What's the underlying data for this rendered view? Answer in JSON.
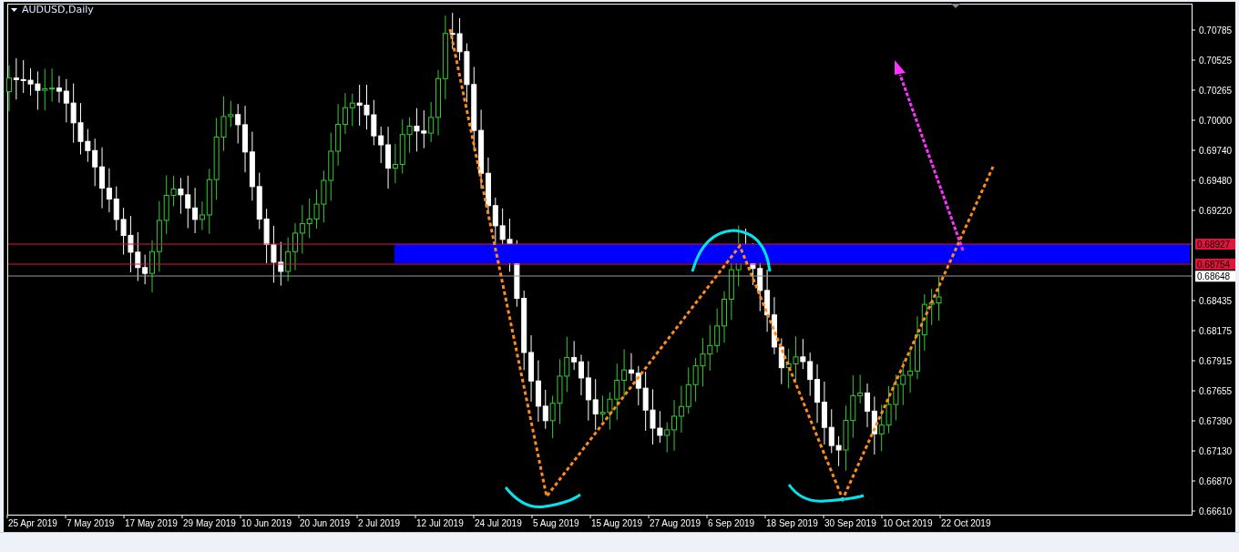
{
  "chart": {
    "title": "AUDUSD,Daily",
    "price_axis": [
      "0.70785",
      "0.70525",
      "0.70265",
      "0.70000",
      "0.69740",
      "0.69480",
      "0.69220",
      "0.68435",
      "0.68175",
      "0.67915",
      "0.67655",
      "0.67390",
      "0.67130",
      "0.66870",
      "0.66610"
    ],
    "price_tags": [
      {
        "label": "0.68927",
        "color": "#e0143c"
      },
      {
        "label": "0.68754",
        "color": "#e0143c"
      },
      {
        "label": "0.68648",
        "color": "#ffffff"
      }
    ],
    "date_axis": [
      "25 Apr 2019",
      "7 May 2019",
      "17 May 2019",
      "29 May 2019",
      "10 Jun 2019",
      "20 Jun 2019",
      "2 Jul 2019",
      "12 Jul 2019",
      "24 Jul 2019",
      "5 Aug 2019",
      "15 Aug 2019",
      "27 Aug 2019",
      "6 Sep 2019",
      "18 Sep 2019",
      "30 Sep 2019",
      "10 Oct 2019",
      "22 Oct 2019"
    ]
  }
}
